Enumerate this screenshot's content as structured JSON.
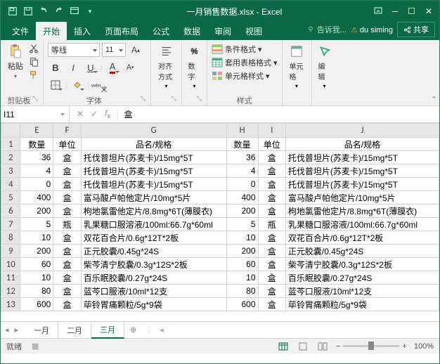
{
  "title": "一月销售数据.xlsx - Excel",
  "tabs": {
    "file": "文件",
    "home": "开始",
    "insert": "插入",
    "layout": "页面布局",
    "formula": "公式",
    "data": "数据",
    "review": "审阅",
    "view": "视图"
  },
  "tell_me": "告诉我...",
  "user": "du siming",
  "share": "共享",
  "clipboard": {
    "paste": "粘贴",
    "label": "剪贴板"
  },
  "font": {
    "name": "等线",
    "size": "11",
    "label": "字体"
  },
  "align": {
    "label": "对齐方式"
  },
  "number": {
    "label": "数字"
  },
  "styles": {
    "cond": "条件格式",
    "table": "套用表格格式",
    "cell": "单元格样式",
    "label": "样式"
  },
  "cells": {
    "label": "单元格"
  },
  "editing": {
    "label": "编辑"
  },
  "namebox": "I11",
  "formula_value": "盒",
  "columns": [
    "E",
    "F",
    "G",
    "H",
    "I",
    "J"
  ],
  "header_row": {
    "E": "数量",
    "F": "单位",
    "G": "品名/规格",
    "H": "数量",
    "I": "单位",
    "J": "品名/规格"
  },
  "rows": [
    {
      "n": 2,
      "E": "36",
      "F": "盒",
      "G": "托伐普坦片(苏麦卡)/15mg*5T",
      "H": "36",
      "I": "盒",
      "J": "托伐普坦片(苏麦卡)/15mg*5T"
    },
    {
      "n": 3,
      "E": "4",
      "F": "盒",
      "G": "托伐普坦片(苏麦卡)/15mg*5T",
      "H": "4",
      "I": "盒",
      "J": "托伐普坦片(苏麦卡)/15mg*5T"
    },
    {
      "n": 4,
      "E": "0",
      "F": "盒",
      "G": "托伐普坦片(苏麦卡)/15mg*5T",
      "H": "0",
      "I": "盒",
      "J": "托伐普坦片(苏麦卡)/15mg*5T"
    },
    {
      "n": 5,
      "E": "400",
      "F": "盒",
      "G": "富马酸卢帕他定片/10mg*5片",
      "H": "400",
      "I": "盒",
      "J": "富马酸卢帕他定片/10mg*5片"
    },
    {
      "n": 6,
      "E": "200",
      "F": "盒",
      "G": "枸地氯雷他定片/8.8mg*6T(薄膜衣)",
      "H": "200",
      "I": "盒",
      "J": "枸地氯雷他定片/8.8mg*6T(薄膜衣)"
    },
    {
      "n": 7,
      "E": "5",
      "F": "瓶",
      "G": "乳果糖口服溶液/100ml:66.7g*60ml",
      "H": "5",
      "I": "瓶",
      "J": "乳果糖口服溶液/100ml:66.7g*60ml"
    },
    {
      "n": 8,
      "E": "10",
      "F": "盒",
      "G": "双花百合片/0.6g*12T*2板",
      "H": "10",
      "I": "盒",
      "J": "双花百合片/0.6g*12T*2板"
    },
    {
      "n": 9,
      "E": "200",
      "F": "盒",
      "G": "正元胶囊/0.45g*24S",
      "H": "200",
      "I": "盒",
      "J": "正元胶囊/0.45g*24S"
    },
    {
      "n": 10,
      "E": "60",
      "F": "盒",
      "G": "柴芩清宁胶囊/0.3g*12S*2板",
      "H": "60",
      "I": "盒",
      "J": "柴芩清宁胶囊/0.3g*12S*2板"
    },
    {
      "n": 11,
      "E": "10",
      "F": "盒",
      "G": "百乐眠胶囊/0.27g*24S",
      "H": "10",
      "I": "盒",
      "J": "百乐眠胶囊/0.27g*24S"
    },
    {
      "n": 12,
      "E": "80",
      "F": "盒",
      "G": "蓝芩口服液/10ml*12支",
      "H": "80",
      "I": "盒",
      "J": "蓝芩口服液/10ml*12支"
    },
    {
      "n": 13,
      "E": "600",
      "F": "盒",
      "G": "荜铃胃痛颗粒/5g*9袋",
      "H": "600",
      "I": "盒",
      "J": "荜铃胃痛颗粒/5g*9袋"
    }
  ],
  "sheets": {
    "s1": "一月",
    "s2": "二月",
    "s3": "三月"
  },
  "status": {
    "ready": "就绪",
    "zoom": "100%"
  },
  "colw": {
    "E": 48,
    "F": 40,
    "G": 208,
    "H": 46,
    "I": 40,
    "J": 220
  }
}
